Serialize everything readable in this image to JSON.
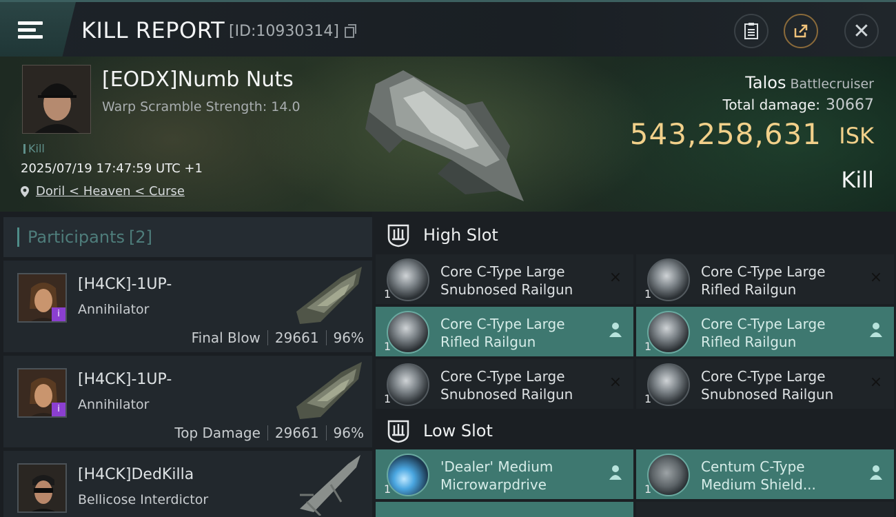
{
  "header": {
    "title": "KILL REPORT",
    "report_id": "[ID:10930314]"
  },
  "victim": {
    "name": "[EODX]Numb Nuts",
    "warp_scramble": "Warp Scramble Strength: 14.0",
    "tag": "Kill",
    "timestamp": "2025/07/19 17:47:59 UTC +1",
    "location": "Doril < Heaven < Curse",
    "ship_name": "Talos",
    "ship_class": "Battlecruiser",
    "damage_label": "Total damage:",
    "damage_value": "30667",
    "isk_value": "543,258,631",
    "isk_unit": "ISK",
    "outcome": "Kill"
  },
  "participants": {
    "label": "Participants",
    "count": "[2]",
    "items": [
      {
        "name": "[H4CK]-1UP-",
        "ship": "Annihilator",
        "role": "Final Blow",
        "damage": "29661",
        "percent": "96%",
        "badge": "i"
      },
      {
        "name": "[H4CK]-1UP-",
        "ship": "Annihilator",
        "role": "Top Damage",
        "damage": "29661",
        "percent": "96%",
        "badge": "i"
      },
      {
        "name": "[H4CK]DedKilla",
        "ship": "Bellicose Interdictor"
      }
    ]
  },
  "fitting": {
    "high_slot_label": "High Slot",
    "low_slot_label": "Low Slot",
    "high": [
      {
        "count": "1",
        "line1": "Core C-Type Large",
        "line2": "Snubnosed Railgun",
        "state": "destroyed",
        "state_icon": "×"
      },
      {
        "count": "1",
        "line1": "Core C-Type Large",
        "line2": "Rifled Railgun",
        "state": "destroyed",
        "state_icon": "×"
      },
      {
        "count": "1",
        "line1": "Core C-Type Large",
        "line2": "Rifled Railgun",
        "state": "dropped",
        "state_icon": "user"
      },
      {
        "count": "1",
        "line1": "Core C-Type Large",
        "line2": "Rifled Railgun",
        "state": "dropped",
        "state_icon": "user"
      },
      {
        "count": "1",
        "line1": "Core C-Type Large",
        "line2": "Snubnosed Railgun",
        "state": "destroyed",
        "state_icon": "×"
      },
      {
        "count": "1",
        "line1": "Core C-Type Large",
        "line2": "Snubnosed Railgun",
        "state": "destroyed",
        "state_icon": "×"
      }
    ],
    "low": [
      {
        "count": "1",
        "line1": "'Dealer' Medium",
        "line2": "Microwarpdrive",
        "state": "dropped",
        "state_icon": "user"
      },
      {
        "count": "1",
        "line1": "Centum C-Type",
        "line2": "Medium Shield...",
        "state": "dropped",
        "state_icon": "user"
      }
    ]
  },
  "colors": {
    "accent_teal": "#3e7870",
    "isk_gold": "#f2d08a",
    "badge_purple": "#8b3fd0"
  }
}
